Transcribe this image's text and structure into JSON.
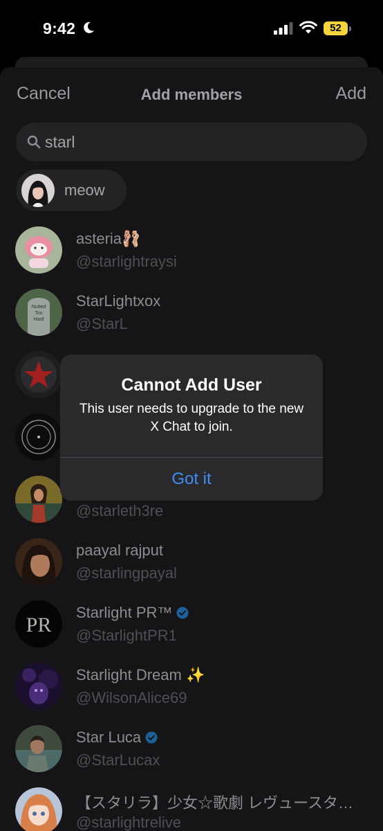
{
  "status_bar": {
    "time": "9:42",
    "battery": "52",
    "icons": [
      "moon-icon",
      "signal-icon",
      "wifi-icon",
      "battery-icon"
    ]
  },
  "nav": {
    "cancel_label": "Cancel",
    "title": "Add members",
    "add_label": "Add"
  },
  "search": {
    "value": "starl",
    "icon": "search-icon"
  },
  "selected_chip": {
    "label": "meow"
  },
  "results": [
    {
      "name": "asteria🩰",
      "handle": "@starlightraysi",
      "verified": false
    },
    {
      "name": "StarLightxox",
      "handle": "@StarL",
      "verified": false
    },
    {
      "name": "",
      "handle": "",
      "verified": false
    },
    {
      "name": "",
      "handle": "",
      "verified": false
    },
    {
      "name": "",
      "handle": "@starleth3re",
      "verified": false
    },
    {
      "name": "paayal rajput",
      "handle": "@starlingpayal",
      "verified": false
    },
    {
      "name": "Starlight PR™",
      "handle": "@StarlightPR1",
      "verified": true
    },
    {
      "name": "Starlight Dream ✨",
      "handle": "@WilsonAlice69",
      "verified": false
    },
    {
      "name": "Star Luca",
      "handle": "@StarLucax",
      "verified": true
    },
    {
      "name": "【スタリラ】少女☆歌劇 レヴュースタァラ…",
      "handle": "@starlightrelive",
      "verified": false
    }
  ],
  "avatar_texts": {
    "tombstone": "Nutted Too Hard",
    "pr_logo": "PR"
  },
  "alert": {
    "title": "Cannot Add User",
    "message": "This user needs to upgrade to the new X Chat to join.",
    "button_label": "Got it"
  },
  "colors": {
    "accent_blue": "#3f8ef5",
    "verified_blue": "#1d9bf0",
    "battery_yellow": "#f5d33d"
  }
}
